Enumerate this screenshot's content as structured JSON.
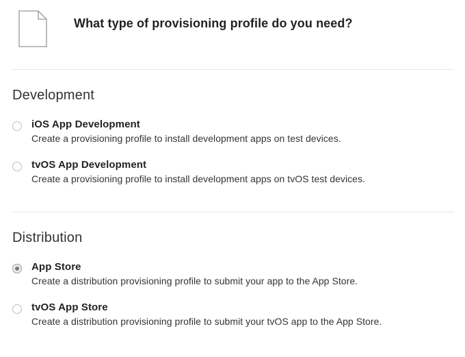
{
  "header": {
    "title": "What type of provisioning profile do you need?"
  },
  "sections": {
    "development": {
      "title": "Development",
      "options": [
        {
          "label": "iOS App Development",
          "description": "Create a provisioning profile to install development apps on test devices.",
          "selected": false
        },
        {
          "label": "tvOS App Development",
          "description": "Create a provisioning profile to install development apps on tvOS test devices.",
          "selected": false
        }
      ]
    },
    "distribution": {
      "title": "Distribution",
      "options": [
        {
          "label": "App Store",
          "description": "Create a distribution provisioning profile to submit your app to the App Store.",
          "selected": true
        },
        {
          "label": "tvOS App Store",
          "description": "Create a distribution provisioning profile to submit your tvOS app to the App Store.",
          "selected": false
        }
      ]
    }
  }
}
